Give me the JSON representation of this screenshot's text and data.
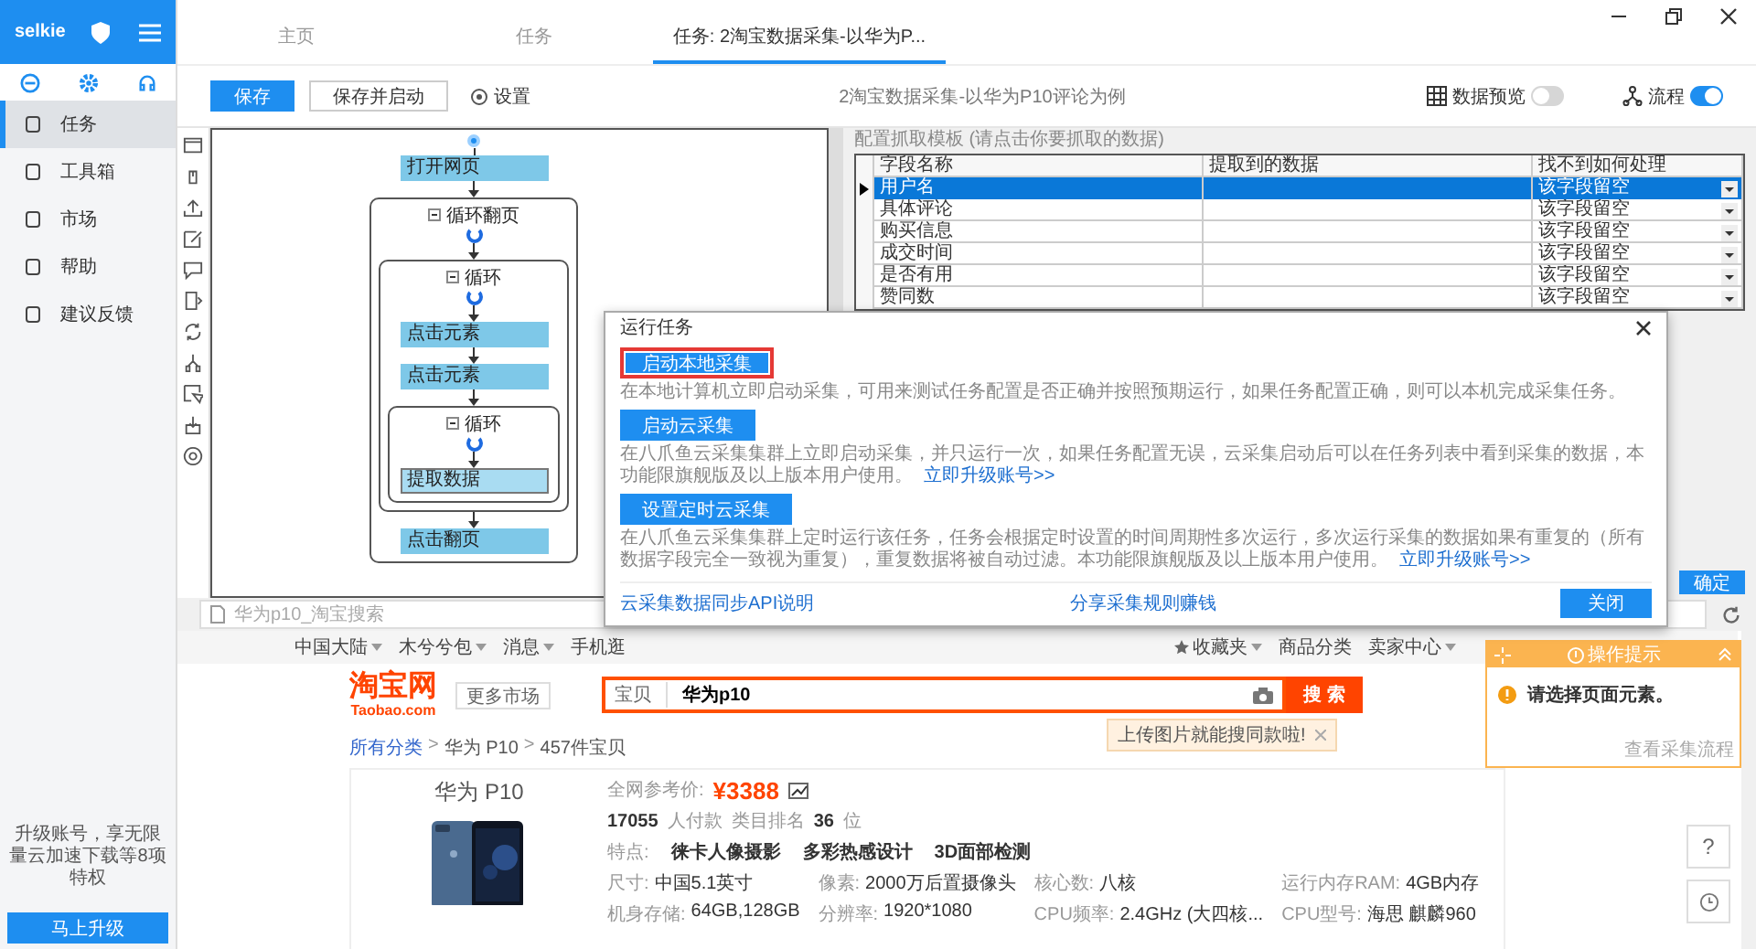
{
  "sidebar": {
    "brand": "selkie",
    "items": [
      {
        "label": "任务",
        "selected": true
      },
      {
        "label": "工具箱",
        "selected": false
      },
      {
        "label": "市场",
        "selected": false
      },
      {
        "label": "帮助",
        "selected": false
      },
      {
        "label": "建议反馈",
        "selected": false
      }
    ],
    "upgrade_text": "升级账号，享无限量云加速下载等8项特权",
    "upgrade_button": "马上升级"
  },
  "tabs": [
    {
      "label": "主页",
      "selected": false
    },
    {
      "label": "任务",
      "selected": false
    },
    {
      "label": "任务: 2淘宝数据采集-以华为P...",
      "selected": true
    }
  ],
  "toolbar": {
    "buttons": [
      {
        "label": "保存",
        "kind": "primary"
      },
      {
        "label": "保存并启动",
        "kind": "outline"
      },
      {
        "label": "设置",
        "kind": "settings"
      }
    ],
    "task_title": "2淘宝数据采集-以华为P10评论为例",
    "toggles": [
      {
        "label": "数据预览",
        "kind": "table",
        "on": false
      },
      {
        "label": "流程",
        "kind": "flow",
        "on": true
      }
    ]
  },
  "flow": [
    {
      "kind": "step",
      "label": "打开网页",
      "selected": false
    },
    {
      "kind": "loop",
      "label": "循环翻页",
      "children": [
        {
          "kind": "loop",
          "label": "循环",
          "children": [
            {
              "kind": "step",
              "label": "点击元素",
              "selected": false
            },
            {
              "kind": "step",
              "label": "点击元素",
              "selected": false
            },
            {
              "kind": "loop",
              "label": "循环",
              "children": [
                {
                  "kind": "step",
                  "label": "提取数据",
                  "selected": true
                }
              ]
            }
          ]
        },
        {
          "kind": "step",
          "label": "点击翻页",
          "selected": false
        }
      ]
    }
  ],
  "template_panel": {
    "caption": "配置抓取模板 (请点击你要抓取的数据)",
    "columns": [
      "字段名称",
      "提取到的数据",
      "找不到如何处理"
    ],
    "rows": [
      {
        "field": "用户名",
        "handling": "该字段留空",
        "selected": true
      },
      {
        "field": "具体评论",
        "handling": "该字段留空",
        "selected": false
      },
      {
        "field": "购买信息",
        "handling": "该字段留空",
        "selected": false
      },
      {
        "field": "成交时间",
        "handling": "该字段留空",
        "selected": false
      },
      {
        "field": "是否有用",
        "handling": "该字段留空",
        "selected": false
      },
      {
        "field": "赞同数",
        "handling": "该字段留空",
        "selected": false
      }
    ],
    "confirm_button": "确定"
  },
  "browser": {
    "address": "华为p10_淘宝搜索",
    "topbar_left": [
      {
        "label": "中国大陆",
        "kind": "menu"
      },
      {
        "label": "木兮兮包",
        "kind": "menu"
      },
      {
        "label": "消息",
        "kind": "menu"
      },
      {
        "label": "手机逛",
        "kind": "plain"
      }
    ],
    "topbar_right": [
      {
        "label": "收藏夹",
        "kind": "favorites"
      },
      {
        "label": "商品分类",
        "kind": "plain"
      },
      {
        "label": "卖家中心",
        "kind": "menu"
      }
    ],
    "logo": "淘宝网",
    "logo_sub": "Taobao.com",
    "more_markets": "更多市场",
    "search_scope": "宝贝",
    "search_value": "华为p10",
    "search_button": "搜 索",
    "search_tip": "上传图片就能搜同款啦!",
    "breadcrumb": [
      {
        "kind": "link",
        "text": "所有分类"
      },
      {
        "kind": "separator",
        "text": ">"
      },
      {
        "kind": "link",
        "text": "华为 P10"
      },
      {
        "kind": "separator",
        "text": ">"
      },
      {
        "kind": "count",
        "text": "457件宝贝"
      }
    ],
    "product": {
      "title": "华为 P10",
      "price_label": "全网参考价:",
      "price": "¥3388",
      "buyers": "17055",
      "buyers_label": "人付款",
      "rank_label": "类目排名",
      "rank": "36",
      "rank_unit": "位",
      "features_label": "特点:",
      "features": [
        "徕卡人像摄影",
        "多彩热感设计",
        "3D面部检测"
      ],
      "specs": [
        {
          "label": "尺寸:",
          "value": "中国5.1英寸"
        },
        {
          "label": "像素:",
          "value": "2000万后置摄像头"
        },
        {
          "label": "核心数:",
          "value": "八核"
        },
        {
          "label": "运行内存RAM:",
          "value": "4GB内存"
        },
        {
          "label": "机身存储:",
          "value": "64GB,128GB"
        },
        {
          "label": "分辨率:",
          "value": "1920*1080"
        },
        {
          "label": "CPU频率:",
          "value": "2.4GHz (大四核..."
        },
        {
          "label": "CPU型号:",
          "value": "海思 麒麟960"
        }
      ]
    },
    "float_help": "?"
  },
  "hint_panel": {
    "title": "操作提示",
    "message": "请选择页面元素。",
    "link": "查看采集流程"
  },
  "dialog": {
    "title": "运行任务",
    "options": [
      {
        "button": "启动本地采集",
        "highlighted": true,
        "description": "在本地计算机立即启动采集，可用来测试任务配置是否正确并按照预期运行，如果任务配置正确，则可以本机完成采集任务。"
      },
      {
        "button": "启动云采集",
        "highlighted": false,
        "description": "在八爪鱼云采集集群上立即启动采集，并只运行一次，如果任务配置无误，云采集启动后可以在任务列表中看到采集的数据，本功能限旗舰版及以上版本用户使用。",
        "link": "立即升级账号>>"
      },
      {
        "button": "设置定时云采集",
        "highlighted": false,
        "description": "在八爪鱼云采集集群上定时运行该任务，任务会根据定时设置的时间周期性多次运行，多次运行采集的数据如果有重复的（所有数据字段完全一致视为重复），重复数据将被自动过滤。本功能限旗舰版及以上版本用户使用。",
        "link": "立即升级账号>>"
      }
    ],
    "footer_links": [
      "云采集数据同步API说明",
      "分享采集规则赚钱"
    ],
    "close_button": "关闭"
  }
}
